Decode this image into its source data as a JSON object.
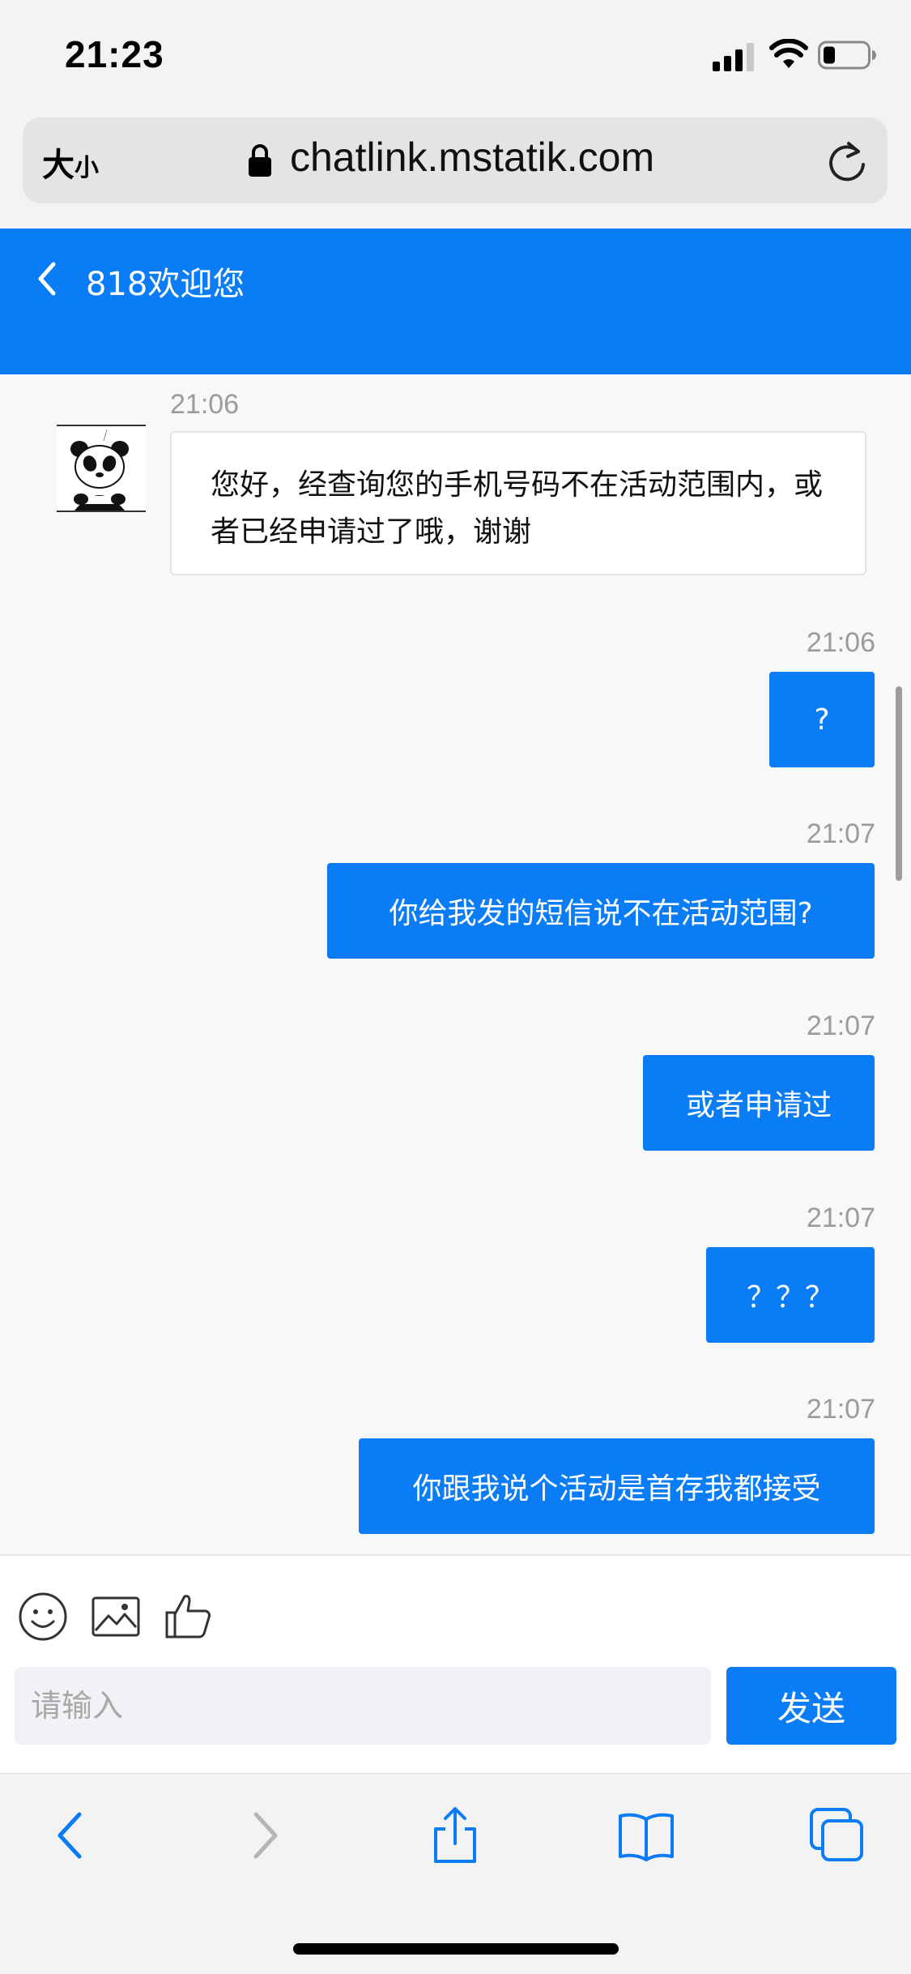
{
  "status_bar": {
    "time": "21:23"
  },
  "address_bar": {
    "text_size_large": "大",
    "text_size_small": "小",
    "url": "chatlink.mstatik.com"
  },
  "chat": {
    "title": "818欢迎您",
    "messages": [
      {
        "direction": "incoming",
        "time": "21:06",
        "text": "您好，经查询您的手机号码不在活动范围内，或者已经申请过了哦，谢谢"
      },
      {
        "direction": "outgoing",
        "time": "21:06",
        "text": "?"
      },
      {
        "direction": "outgoing",
        "time": "21:07",
        "text": "你给我发的短信说不在活动范围?"
      },
      {
        "direction": "outgoing",
        "time": "21:07",
        "text": "或者申请过"
      },
      {
        "direction": "outgoing",
        "time": "21:07",
        "text": "？？？"
      },
      {
        "direction": "outgoing",
        "time": "21:07",
        "text": "你跟我说个活动是首存我都接受"
      }
    ]
  },
  "composer": {
    "tools": [
      "emoji-icon",
      "image-icon",
      "thumbs-up-icon"
    ],
    "placeholder": "请输入",
    "value": "",
    "send_label": "发送"
  },
  "browser_toolbar": {
    "icons": [
      "back-icon",
      "forward-icon",
      "share-icon",
      "bookmarks-icon",
      "tabs-icon"
    ]
  },
  "colors": {
    "accent": "#0a7cf5",
    "background": "#f8f8f8",
    "timestamp": "#9b9b9b"
  }
}
